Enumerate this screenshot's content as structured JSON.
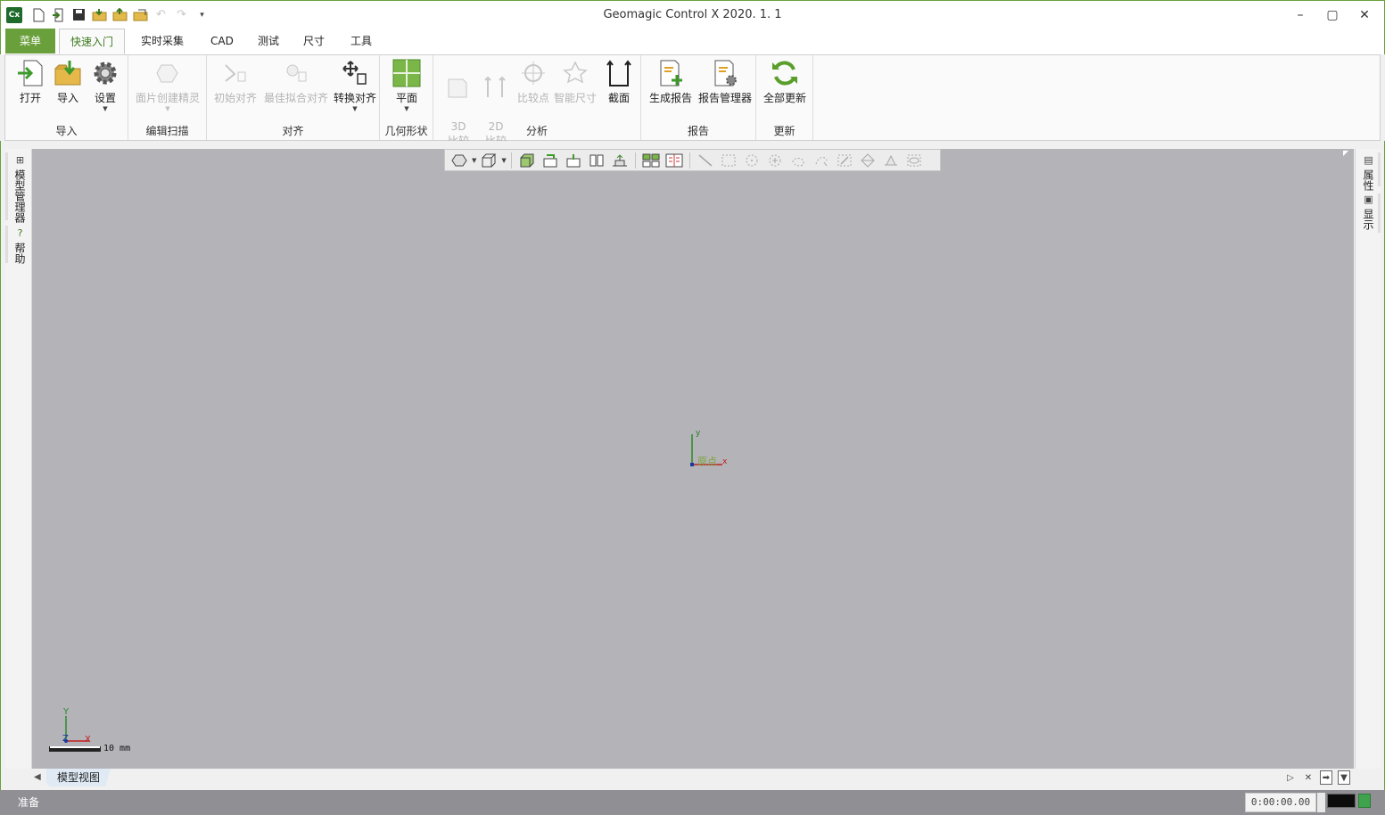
{
  "window": {
    "app_icon": "Cx",
    "title": "Geomagic Control X 2020. 1. 1",
    "quick_access": [
      "new-file-icon",
      "import-icon",
      "save-icon",
      "open-folder-icon",
      "open-folder-icon",
      "open-recent-icon",
      "undo-icon",
      "redo-icon",
      "customize-icon"
    ],
    "controls": {
      "minimize": "–",
      "maximize": "▢",
      "close": "✕"
    }
  },
  "ribbon_tabs": {
    "menu": "菜单",
    "items": [
      "快速入门",
      "实时采集",
      "CAD",
      "测试",
      "尺寸",
      "工具"
    ],
    "active": "快速入门"
  },
  "ribbon": {
    "import": {
      "label": "导入",
      "buttons": [
        "打开",
        "导入",
        "设置"
      ]
    },
    "edit_scan": {
      "label": "编辑扫描",
      "buttons": [
        "面片创建精灵"
      ]
    },
    "align": {
      "label": "对齐",
      "buttons": [
        "初始对齐",
        "最佳拟合对齐",
        "转换对齐"
      ]
    },
    "geometry": {
      "label": "几何形状",
      "buttons": [
        "平面"
      ]
    },
    "analysis": {
      "label": "分析",
      "buttons": [
        "3D\n比较",
        "2D\n比较",
        "比较点",
        "智能尺寸",
        "截面"
      ]
    },
    "report": {
      "label": "报告",
      "buttons": [
        "生成报告",
        "报告管理器"
      ]
    },
    "update": {
      "label": "更新",
      "buttons": [
        "全部更新"
      ]
    }
  },
  "left_dock": {
    "tabs": [
      "模型管理器",
      "帮助"
    ]
  },
  "right_dock": {
    "tabs": [
      "属性",
      "显示"
    ]
  },
  "viewport": {
    "origin_label": "原点",
    "axis_x": "x",
    "axis_y": "y",
    "triad_x": "X",
    "triad_y": "Y",
    "triad_z": "Z",
    "scale": "10 mm"
  },
  "view_tabs": {
    "items": [
      "模型视图"
    ]
  },
  "status": {
    "text": "准备",
    "time": "0:00:00.00"
  },
  "colors": {
    "accent": "#6aa03c",
    "viewport_bg": "#b4b3b8",
    "status_bg": "#8f8f94"
  }
}
